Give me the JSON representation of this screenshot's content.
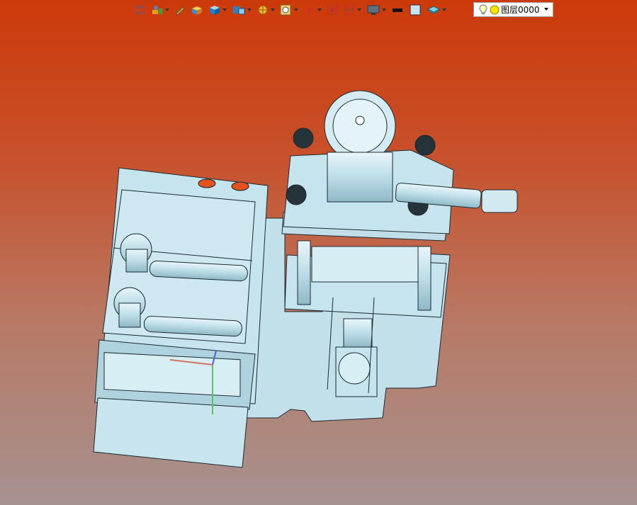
{
  "toolbar": {
    "buttons": [
      {
        "id": "view-orient",
        "icon": "view-orientation-icon"
      },
      {
        "id": "render",
        "icon": "render-style-icon"
      },
      {
        "id": "sketch",
        "icon": "pencil-icon"
      },
      {
        "id": "shade",
        "icon": "shaded-box-icon"
      },
      {
        "id": "iso",
        "icon": "isometric-cube-icon"
      },
      {
        "id": "views",
        "icon": "standard-views-icon"
      },
      {
        "id": "section",
        "icon": "section-view-icon"
      },
      {
        "id": "zoom",
        "icon": "zoom-icon"
      },
      {
        "id": "axes",
        "icon": "axes-triad-icon"
      },
      {
        "id": "fit",
        "icon": "fit-view-icon"
      },
      {
        "id": "bounds",
        "icon": "bounding-box-icon"
      },
      {
        "id": "display",
        "icon": "display-monitor-icon"
      },
      {
        "id": "line-color",
        "icon": "line-color-icon"
      },
      {
        "id": "face-color",
        "icon": "face-color-icon"
      },
      {
        "id": "layer-style",
        "icon": "layer-style-icon"
      }
    ],
    "layer": {
      "label": "图层0000",
      "bulb_icon": "lightbulb-icon",
      "color_icon": "yellow-circle-icon"
    }
  },
  "colors": {
    "part_fill": "#c6e4ee",
    "part_stroke": "#1c2a30",
    "accent_red": "#e0531e"
  }
}
